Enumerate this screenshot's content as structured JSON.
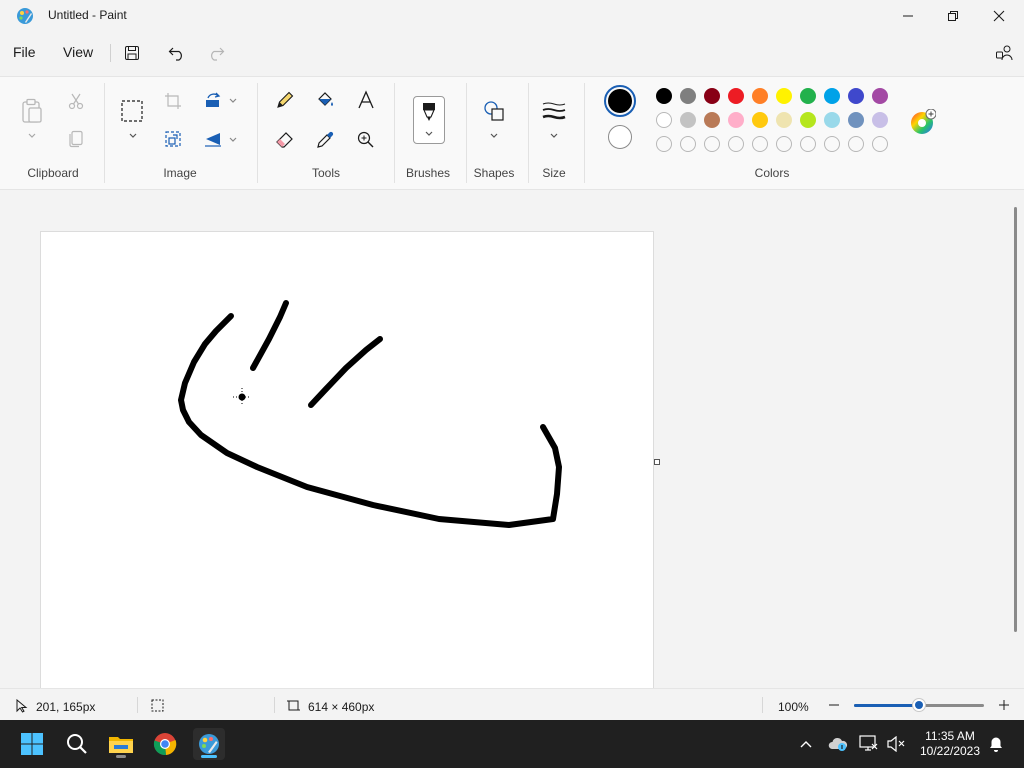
{
  "window": {
    "title": "Untitled - Paint"
  },
  "menu": {
    "file": "File",
    "view": "View"
  },
  "ribbon": {
    "groups": {
      "clipboard": "Clipboard",
      "image": "Image",
      "tools": "Tools",
      "brushes": "Brushes",
      "shapes": "Shapes",
      "size": "Size",
      "colors": "Colors"
    },
    "primary_color": "#000000",
    "secondary_color": "#ffffff",
    "palette_row1": [
      "#000000",
      "#7f7f7f",
      "#880015",
      "#ed1c24",
      "#ff7f27",
      "#fff200",
      "#22b14c",
      "#00a2e8",
      "#3f48cc",
      "#a349a4"
    ],
    "palette_row2": [
      "#ffffff",
      "#c3c3c3",
      "#b97a57",
      "#ffaec9",
      "#ffc90e",
      "#efe4b0",
      "#b5e61d",
      "#99d9ea",
      "#7092be",
      "#c8bfe7"
    ],
    "palette_row3_count": 10
  },
  "status": {
    "cursor_position": "201, 165px",
    "canvas_size": "614 × 460px",
    "zoom": "100%",
    "zoom_fraction": 0.5
  },
  "taskbar": {
    "time": "11:35 AM",
    "date": "10/22/2023"
  }
}
